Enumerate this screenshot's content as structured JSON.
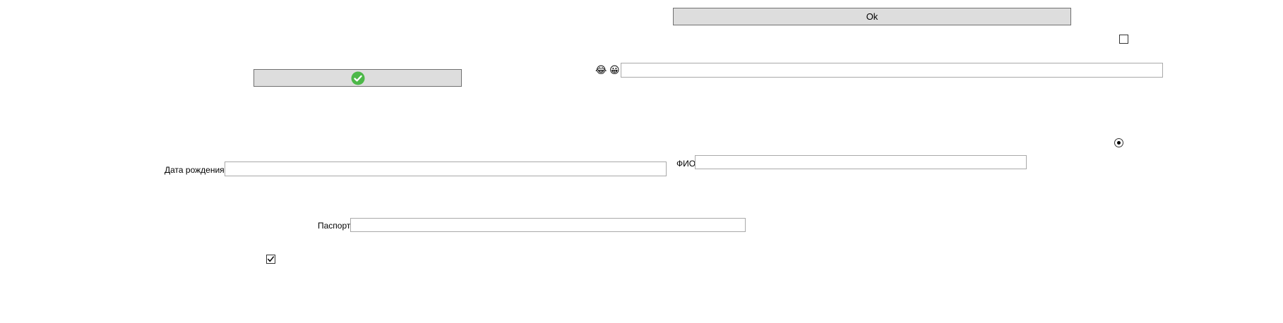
{
  "ok_button": {
    "label": "Ok"
  },
  "confirm_button": {
    "icon": "check-circle-icon",
    "icon_color": "#4cb848"
  },
  "smiley_icons": [
    {
      "name": "grinning-face-with-tears-icon",
      "glyph": "😂"
    },
    {
      "name": "grinning-face-icon",
      "glyph": "😀"
    }
  ],
  "fields": {
    "fio": {
      "label": "ФИО",
      "value": ""
    },
    "birth_date": {
      "label": "Дата рождения",
      "value": ""
    },
    "passport": {
      "label": "Паспорт",
      "value": ""
    },
    "emoji_text": {
      "value": ""
    }
  },
  "top_checkbox": {
    "checked": false
  },
  "radio": {
    "selected": true
  },
  "bottom_checkbox": {
    "checked": true
  },
  "colors": {
    "button_bg": "#dddddd",
    "field_border": "#a9a9a9"
  }
}
